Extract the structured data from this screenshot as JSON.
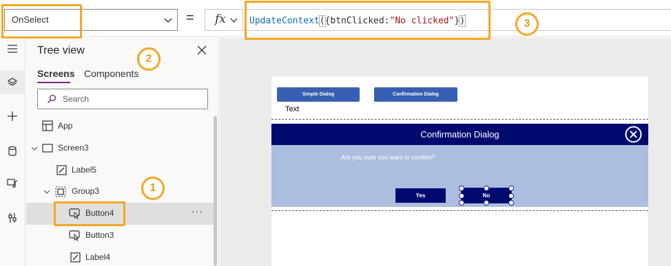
{
  "formula_bar": {
    "property": "OnSelect",
    "equals": "=",
    "fx": "fx",
    "formula": {
      "fn": "UpdateContext",
      "open_paren": "(",
      "open_brace": "{btnClicked:",
      "string": "\"No clicked\"",
      "close_brace": "}",
      "close_paren": ")"
    }
  },
  "callouts": [
    "1",
    "2",
    "3"
  ],
  "rail": {
    "icons": [
      "hamburger-icon",
      "layers-icon",
      "plus-icon",
      "database-icon",
      "media-icon",
      "tools-icon"
    ]
  },
  "tree": {
    "title": "Tree view",
    "tabs": [
      "Screens",
      "Components"
    ],
    "search_placeholder": "Search",
    "nodes": [
      {
        "label": "App",
        "icon": "app-icon"
      },
      {
        "label": "Screen3",
        "icon": "screen-icon"
      },
      {
        "label": "Label5",
        "icon": "label-icon"
      },
      {
        "label": "Group3",
        "icon": "group-icon"
      },
      {
        "label": "Button4",
        "icon": "button-icon",
        "selected": true
      },
      {
        "label": "Button3",
        "icon": "button-icon"
      },
      {
        "label": "Label4",
        "icon": "label-icon"
      }
    ],
    "more": "···"
  },
  "canvas": {
    "buttons": [
      "Simple Dialog",
      "Confirmation Dialog"
    ],
    "text_label": "Text",
    "dialog": {
      "title": "Confirmation Dialog",
      "message": "Are you sure you want to confirm?",
      "yes": "Yes",
      "no": "No"
    }
  },
  "colors": {
    "highlight": "#f5a623",
    "dialog_header": "#000a6e",
    "dialog_body": "#acbde0",
    "app_button": "#3860b2",
    "tab_accent": "#742774"
  }
}
